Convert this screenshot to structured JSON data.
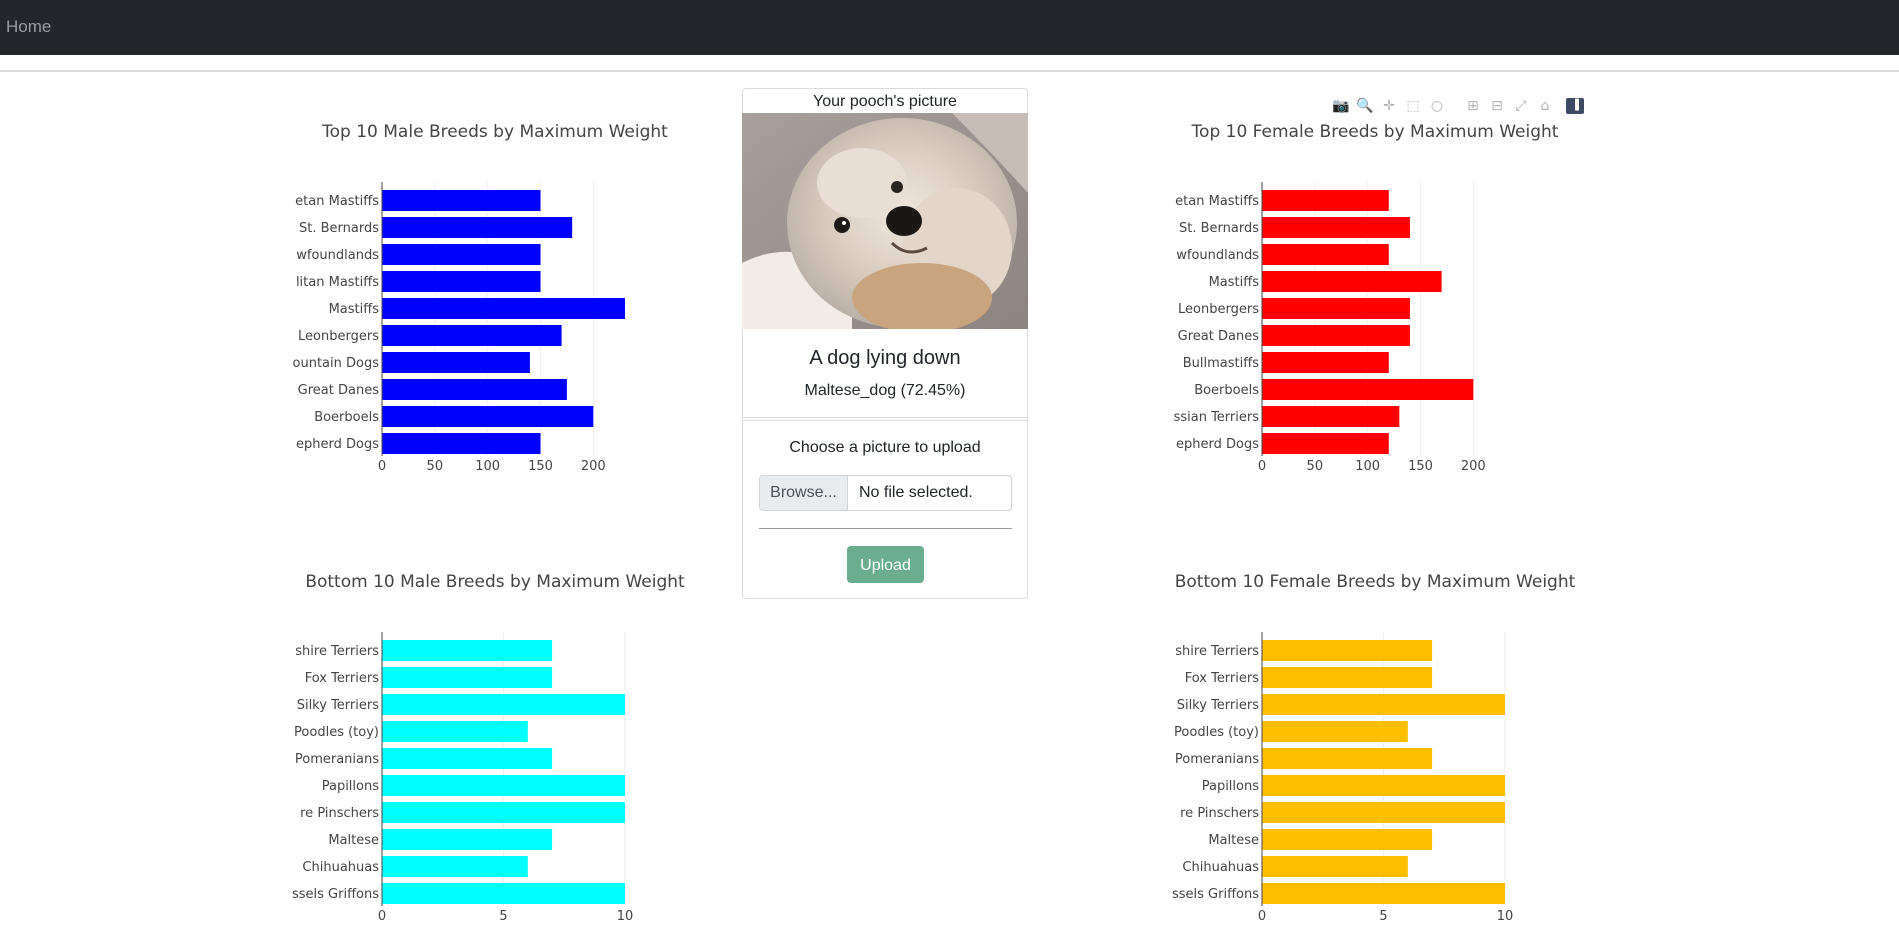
{
  "nav": {
    "home_label": "Home"
  },
  "card": {
    "header": "Your pooch's picture",
    "caption": "A dog lying down",
    "prediction": "Maltese_dog (72.45%)",
    "upload_label": "Choose a picture to upload",
    "browse_label": "Browse...",
    "file_status": "No file selected.",
    "upload_button": "Upload"
  },
  "modebar": {
    "icons": [
      "camera-icon",
      "zoom-icon",
      "pan-icon",
      "box-select-icon",
      "lasso-icon",
      "zoom-in-icon",
      "zoom-out-icon",
      "autoscale-icon",
      "reset-axes-icon",
      "plotly-logo-icon"
    ]
  },
  "chart_data": [
    {
      "id": "male-top",
      "type": "bar",
      "orientation": "horizontal",
      "title": "Top 10 Male Breeds by Maximum Weight",
      "color": "#0000ff",
      "categories": [
        "etan Mastiffs",
        "St. Bernards",
        "wfoundlands",
        "litan Mastiffs",
        "Mastiffs",
        "Leonbergers",
        "ountain Dogs",
        "Great Danes",
        "Boerboels",
        "epherd Dogs"
      ],
      "values": [
        150,
        180,
        150,
        150,
        230,
        170,
        140,
        175,
        200,
        150
      ],
      "xticks": [
        0,
        50,
        100,
        150,
        200
      ],
      "xlim": [
        0,
        230
      ],
      "grid": true
    },
    {
      "id": "female-top",
      "type": "bar",
      "orientation": "horizontal",
      "title": "Top 10 Female Breeds by Maximum Weight",
      "color": "#ff0000",
      "categories": [
        "etan Mastiffs",
        "St. Bernards",
        "wfoundlands",
        "Mastiffs",
        "Leonbergers",
        "Great Danes",
        "Bullmastiffs",
        "Boerboels",
        "ssian Terriers",
        "epherd Dogs"
      ],
      "values": [
        120,
        140,
        120,
        170,
        140,
        140,
        120,
        200,
        130,
        120
      ],
      "xticks": [
        0,
        50,
        100,
        150,
        200
      ],
      "xlim": [
        0,
        200
      ],
      "grid": true
    },
    {
      "id": "male-bottom",
      "type": "bar",
      "orientation": "horizontal",
      "title": "Bottom 10 Male Breeds by Maximum Weight",
      "color": "#00ffff",
      "categories": [
        "shire Terriers",
        "Fox Terriers",
        "Silky Terriers",
        "Poodles (toy)",
        "Pomeranians",
        "Papillons",
        "re Pinschers",
        "Maltese",
        "Chihuahuas",
        "ssels Griffons"
      ],
      "values": [
        7,
        7,
        10,
        6,
        7,
        10,
        10,
        7,
        6,
        10
      ],
      "xticks": [
        0,
        5,
        10
      ],
      "xlim": [
        0,
        10
      ],
      "grid": true
    },
    {
      "id": "female-bottom",
      "type": "bar",
      "orientation": "horizontal",
      "title": "Bottom 10 Female Breeds by Maximum Weight",
      "color": "#ffbf00",
      "categories": [
        "shire Terriers",
        "Fox Terriers",
        "Silky Terriers",
        "Poodles (toy)",
        "Pomeranians",
        "Papillons",
        "re Pinschers",
        "Maltese",
        "Chihuahuas",
        "ssels Griffons"
      ],
      "values": [
        7,
        7,
        10,
        6,
        7,
        10,
        10,
        7,
        6,
        10
      ],
      "xticks": [
        0,
        5,
        10
      ],
      "xlim": [
        0,
        10
      ],
      "grid": true
    }
  ]
}
